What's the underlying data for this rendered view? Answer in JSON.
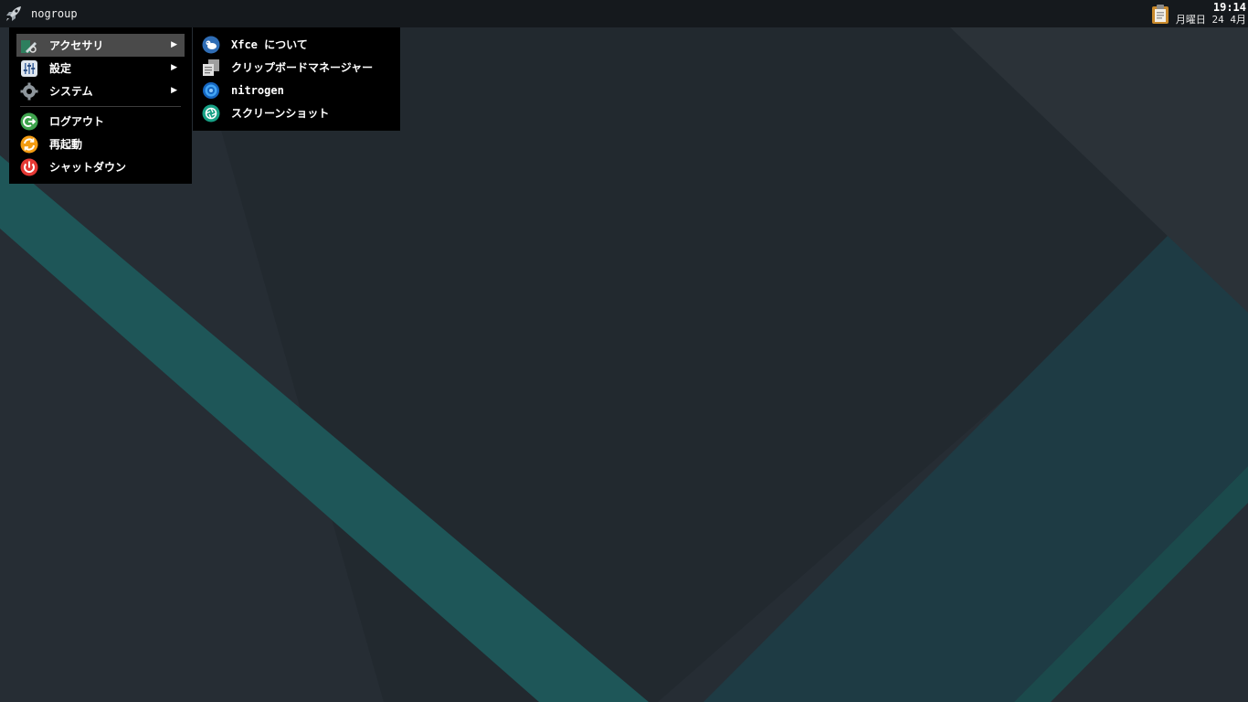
{
  "panel": {
    "menu_button_label": "nogroup",
    "clock_time": "19:14",
    "clock_date": "月曜日 24 4月"
  },
  "main_menu": {
    "items": [
      {
        "label": "アクセサリ",
        "icon": "accessories-icon",
        "has_submenu": true,
        "active": true
      },
      {
        "label": "設定",
        "icon": "settings-icon",
        "has_submenu": true
      },
      {
        "label": "システム",
        "icon": "system-gear-icon",
        "has_submenu": true
      },
      {
        "label": "ログアウト",
        "icon": "logout-icon"
      },
      {
        "label": "再起動",
        "icon": "restart-icon"
      },
      {
        "label": "シャットダウン",
        "icon": "shutdown-icon"
      }
    ],
    "submenu_arrow": "▶"
  },
  "sub_menu": {
    "items": [
      {
        "label": "Xfce について",
        "icon": "xfce-mouse-icon"
      },
      {
        "label": "クリップボードマネージャー",
        "icon": "clipboard-manager-icon"
      },
      {
        "label": "nitrogen",
        "icon": "nitrogen-icon"
      },
      {
        "label": "スクリーンショット",
        "icon": "screenshot-icon"
      }
    ]
  },
  "colors": {
    "wallpaper_base": "#262d34",
    "wallpaper_teal": "#1f5c5d",
    "panel_bg": "#15191d",
    "menu_bg": "#000000",
    "menu_active": "#4a4a4a"
  }
}
